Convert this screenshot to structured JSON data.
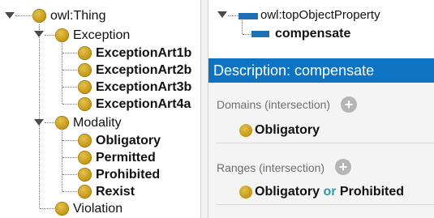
{
  "class_tree": {
    "root": {
      "label": "owl:Thing",
      "icon": "class-circle-icon"
    },
    "exception": {
      "label": "Exception",
      "children": [
        "ExceptionArt1b",
        "ExceptionArt2b",
        "ExceptionArt3b",
        "ExceptionArt4a"
      ]
    },
    "modality": {
      "label": "Modality",
      "children": [
        "Obligatory",
        "Permitted",
        "Prohibited",
        "Rexist"
      ]
    },
    "violation": {
      "label": "Violation"
    }
  },
  "property_tree": {
    "root": "owl:topObjectProperty",
    "selected": "compensate"
  },
  "description": {
    "title": "Description: compensate",
    "domains": {
      "title": "Domains (intersection)",
      "add_symbol": "+",
      "entry": "Obligatory"
    },
    "ranges": {
      "title": "Ranges (intersection)",
      "add_symbol": "+",
      "entry_left": "Obligatory",
      "connector": "or",
      "entry_right": "Prohibited"
    }
  },
  "colors": {
    "class_icon": "#c89a1a",
    "property_icon": "#1f6fb5",
    "header_bg": "#0d73c2",
    "or_connector": "#2a9fb0"
  }
}
